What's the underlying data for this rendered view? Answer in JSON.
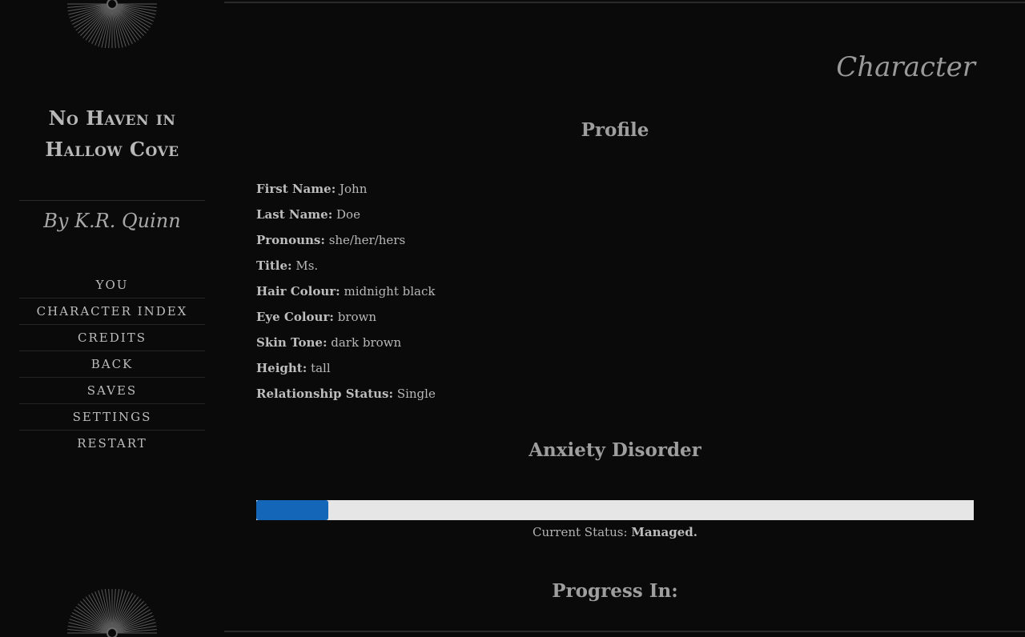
{
  "sidebar": {
    "story_title": "No Haven in Hallow Cove",
    "author": "By K.R. Quinn",
    "nav": [
      "YOU",
      "CHARACTER INDEX",
      "CREDITS",
      "BACK",
      "SAVES",
      "SETTINGS",
      "RESTART"
    ]
  },
  "main": {
    "passage_title": "Character",
    "profile_heading": "Profile",
    "profile": [
      {
        "label": "First Name:",
        "value": "John"
      },
      {
        "label": "Last Name:",
        "value": "Doe"
      },
      {
        "label": "Pronouns:",
        "value": "she/her/hers"
      },
      {
        "label": "Title:",
        "value": "Ms."
      },
      {
        "label": "Hair Colour:",
        "value": "midnight black"
      },
      {
        "label": "Eye Colour:",
        "value": "brown"
      },
      {
        "label": "Skin Tone:",
        "value": "dark brown"
      },
      {
        "label": "Height:",
        "value": "tall"
      },
      {
        "label": "Relationship Status:",
        "value": "Single"
      }
    ],
    "anxiety_heading": "Anxiety Disorder",
    "anxiety_level_fraction": 0.1,
    "status_label": "Current Status:",
    "status_value": "Managed.",
    "progress_heading": "Progress In:"
  },
  "colors": {
    "background": "#0a0a0a",
    "bar_fill": "#1466b8",
    "bar_track": "#e6e6e6"
  }
}
